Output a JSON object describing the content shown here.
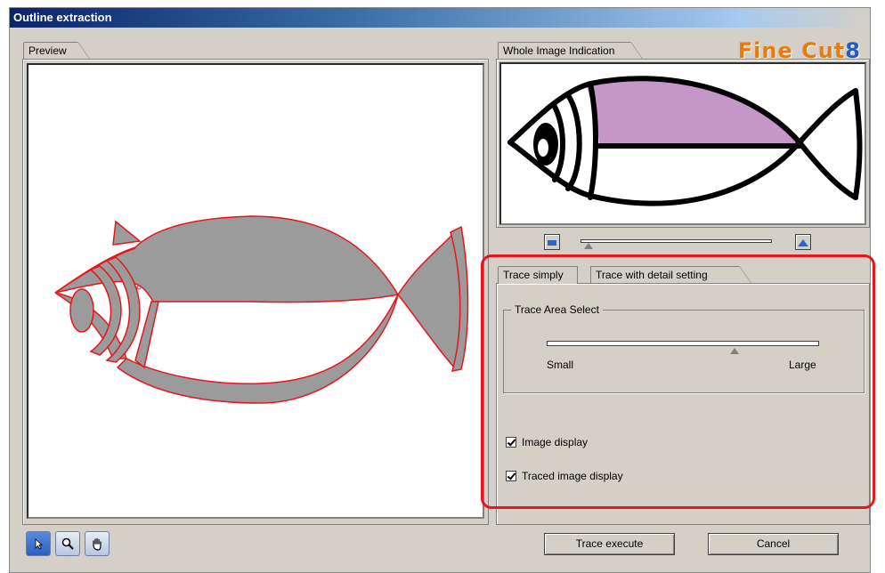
{
  "window": {
    "title": "Outline extraction"
  },
  "preview": {
    "tab_label": "Preview"
  },
  "whole_image": {
    "tab_label": "Whole Image Indication"
  },
  "logo": {
    "text": "Fine Cut",
    "number": "8"
  },
  "tabs": {
    "trace_simply": "Trace simply",
    "trace_detail": "Trace with detail setting"
  },
  "trace_area": {
    "legend": "Trace Area Select",
    "min_label": "Small",
    "max_label": "Large",
    "level": 0.69
  },
  "zoom": {
    "level": 0.0
  },
  "checkboxes": {
    "image_display": "Image display",
    "traced_image_display": "Traced image display"
  },
  "buttons": {
    "trace_execute": "Trace execute",
    "cancel": "Cancel"
  },
  "icons": [
    "arrow-select-icon",
    "magnifier-icon",
    "hand-pan-icon"
  ],
  "colors": {
    "highlight": "#e5161c",
    "fish_fill_preview": "#9b9b9b",
    "fish_outline_trace": "#e5161c",
    "fish_fill_whole": "#c596c8"
  }
}
